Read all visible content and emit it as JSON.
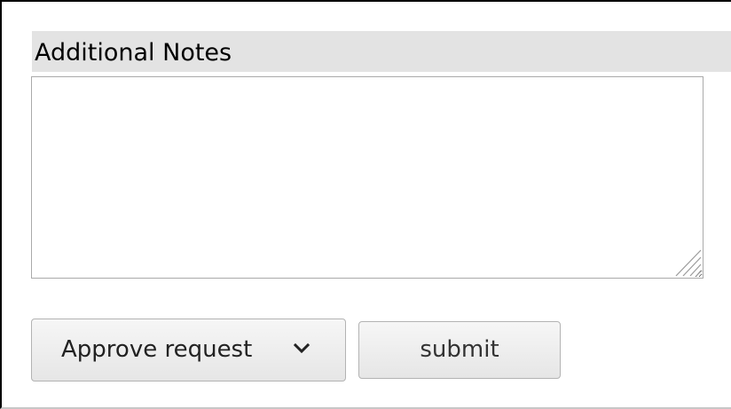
{
  "section": {
    "title": "Additional Notes"
  },
  "notes": {
    "value": "",
    "placeholder": ""
  },
  "action_select": {
    "selected": "Approve request",
    "icon": "chevron-down-icon"
  },
  "submit": {
    "label": "submit"
  },
  "colors": {
    "header_background": "#e3e3e3",
    "button_background": "#eeeeee",
    "border": "#aaaaaa"
  }
}
